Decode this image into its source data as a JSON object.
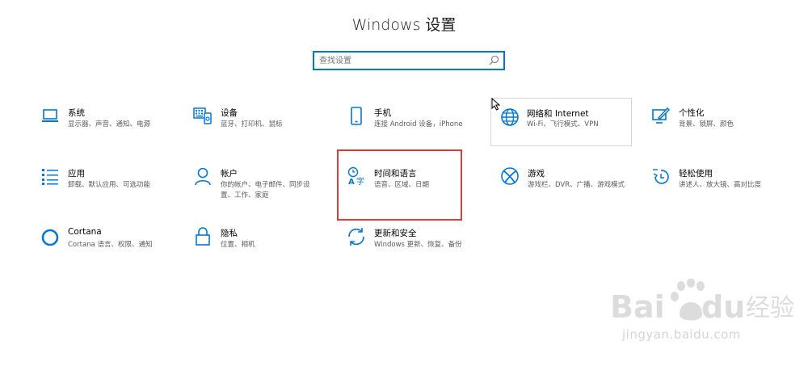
{
  "window_title": "Windows 设置",
  "search": {
    "placeholder": "查找设置"
  },
  "tiles": [
    {
      "name": "系统",
      "desc": "显示器、声音、通知、电源",
      "icon": "laptop-icon"
    },
    {
      "name": "设备",
      "desc": "蓝牙、打印机、鼠标",
      "icon": "keyboard-device-icon"
    },
    {
      "name": "手机",
      "desc": "连接 Android 设备，iPhone",
      "icon": "phone-icon"
    },
    {
      "name": "网络和 Internet",
      "desc": "Wi-Fi、飞行模式、VPN",
      "icon": "globe-icon"
    },
    {
      "name": "个性化",
      "desc": "背景、锁屏、颜色",
      "icon": "personalization-icon"
    },
    {
      "name": "应用",
      "desc": "卸载、默认应用、可选功能",
      "icon": "apps-list-icon"
    },
    {
      "name": "帐户",
      "desc": "你的帐户、电子邮件、同步设置、工作、家庭",
      "icon": "person-icon"
    },
    {
      "name": "时间和语言",
      "desc": "语音、区域、日期",
      "icon": "time-language-icon"
    },
    {
      "name": "游戏",
      "desc": "游戏栏、DVR、广播、游戏模式",
      "icon": "xbox-icon"
    },
    {
      "name": "轻松使用",
      "desc": "讲述人、放大镜、高对比度",
      "icon": "ease-of-access-icon"
    },
    {
      "name": "Cortana",
      "desc": "Cortana 语言、权限、通知",
      "icon": "cortana-icon"
    },
    {
      "name": "隐私",
      "desc": "位置、相机",
      "icon": "lock-icon"
    },
    {
      "name": "更新和安全",
      "desc": "Windows 更新、恢复、备份",
      "icon": "sync-icon"
    }
  ],
  "colors": {
    "accent": "#0078d7",
    "highlight": "#e53935"
  },
  "watermark": {
    "text": "jingyan.baidu.com",
    "logo_text": "Baidu经验"
  }
}
